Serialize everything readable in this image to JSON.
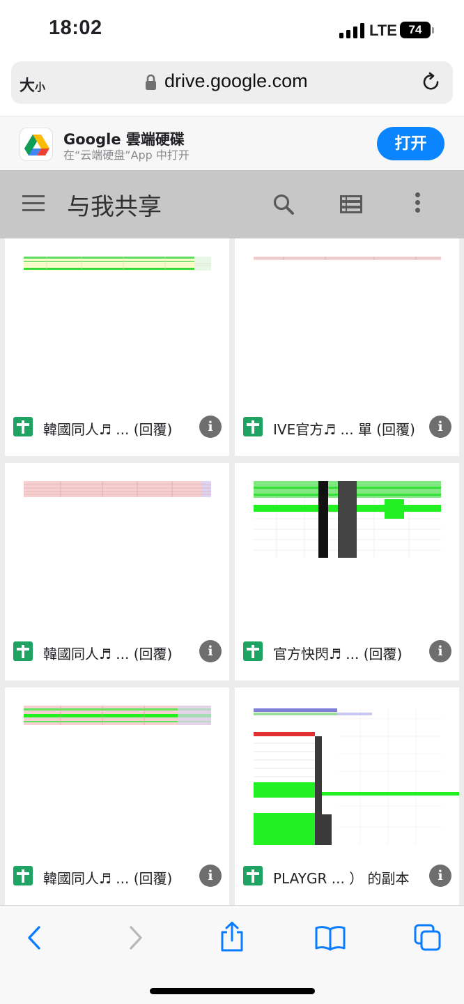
{
  "status_bar": {
    "time": "18:02",
    "network": "LTE",
    "battery": "74"
  },
  "browser": {
    "text_size_large": "大",
    "text_size_small": "小",
    "url": "drive.google.com"
  },
  "app_banner": {
    "title": "Google 雲端硬碟",
    "subtitle": "在“云端硬盘”App 中打开",
    "open_label": "打开"
  },
  "drive_header": {
    "title": "与我共享"
  },
  "files": [
    {
      "name": "韓國同人♬ ... (回覆)",
      "type": "Google Sheets"
    },
    {
      "name": "IVE官方♬ ... 單 (回覆)",
      "type": "Google Sheets"
    },
    {
      "name": "韓國同人♬ ... (回覆)",
      "type": "Google Sheets"
    },
    {
      "name": "官方快閃♬ ... (回覆)",
      "type": "Google Sheets"
    },
    {
      "name": "韓國同人♬ ... (回覆)",
      "type": "Google Sheets"
    },
    {
      "name": "PLAYGR ... ） 的副本",
      "type": "Google Sheets"
    }
  ],
  "colors": {
    "sheets_green": "#1ea362",
    "ios_blue": "#0a84ff",
    "header_gray": "#c7c7c7"
  }
}
